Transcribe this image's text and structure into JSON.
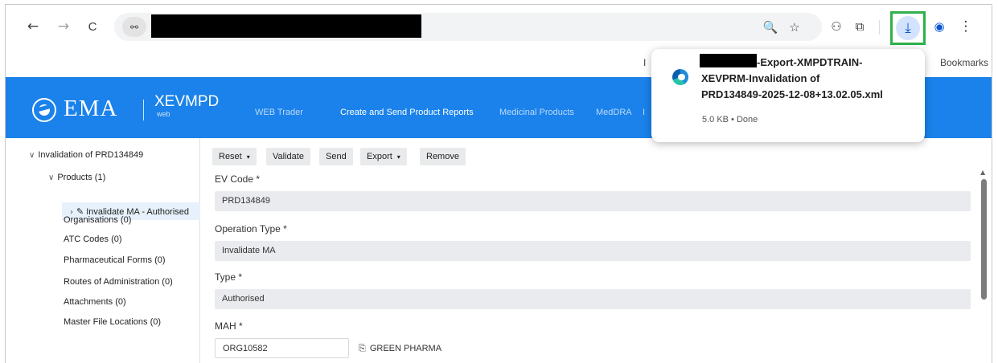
{
  "browser": {
    "back_icon": "←",
    "forward_icon": "→",
    "reload_icon": "C",
    "site_info_icon": "⚯",
    "zoom_icon": "🔍",
    "star_icon": "☆",
    "extension_icon": "⚇",
    "puzzle_icon": "⧉",
    "download_icon": "⤓",
    "profile_icon": "◉",
    "menu_icon": "⋮",
    "download_highlight_color": "#2fb14b"
  },
  "bookmarks": {
    "partial_label": "I",
    "bar_label": "Bookmarks"
  },
  "download_popup": {
    "filename_line1": "-Export-XMPDTRAIN-",
    "filename_line2": "XEVPRM-Invalidation of",
    "filename_line3": "PRD134849-2025-12-08+13.02.05.xml",
    "meta": "5.0 KB • Done"
  },
  "ema": {
    "brand": "EMA",
    "app_name": "XEVMPD",
    "app_sub": "web",
    "header_color": "#1a82ea",
    "nav": [
      {
        "label": "WEB Trader",
        "active": false
      },
      {
        "label": "Create and Send Product Reports",
        "active": true
      },
      {
        "label": "Medicinal Products",
        "active": false
      },
      {
        "label": "MedDRA",
        "active": false
      },
      {
        "label": "I",
        "active": false
      }
    ]
  },
  "sidebar": {
    "root": "Invalidation of PRD134849",
    "products": "Products (1)",
    "selected_item": "Invalidate MA - Authorised",
    "items": [
      "Organisations (0)",
      "ATC Codes (0)",
      "Pharmaceutical Forms (0)",
      "Routes of Administration (0)",
      "Attachments (0)",
      "Master File Locations (0)"
    ]
  },
  "form": {
    "buttons": {
      "reset": "Reset",
      "validate": "Validate",
      "send": "Send",
      "export": "Export",
      "remove": "Remove"
    },
    "ev_code_label": "EV Code *",
    "ev_code_value": "PRD134849",
    "operation_type_label": "Operation Type *",
    "operation_type_value": "Invalidate MA",
    "type_label": "Type *",
    "type_value": "Authorised",
    "mah_label": "MAH *",
    "mah_value": "ORG10582",
    "mah_name": "GREEN PHARMA"
  }
}
